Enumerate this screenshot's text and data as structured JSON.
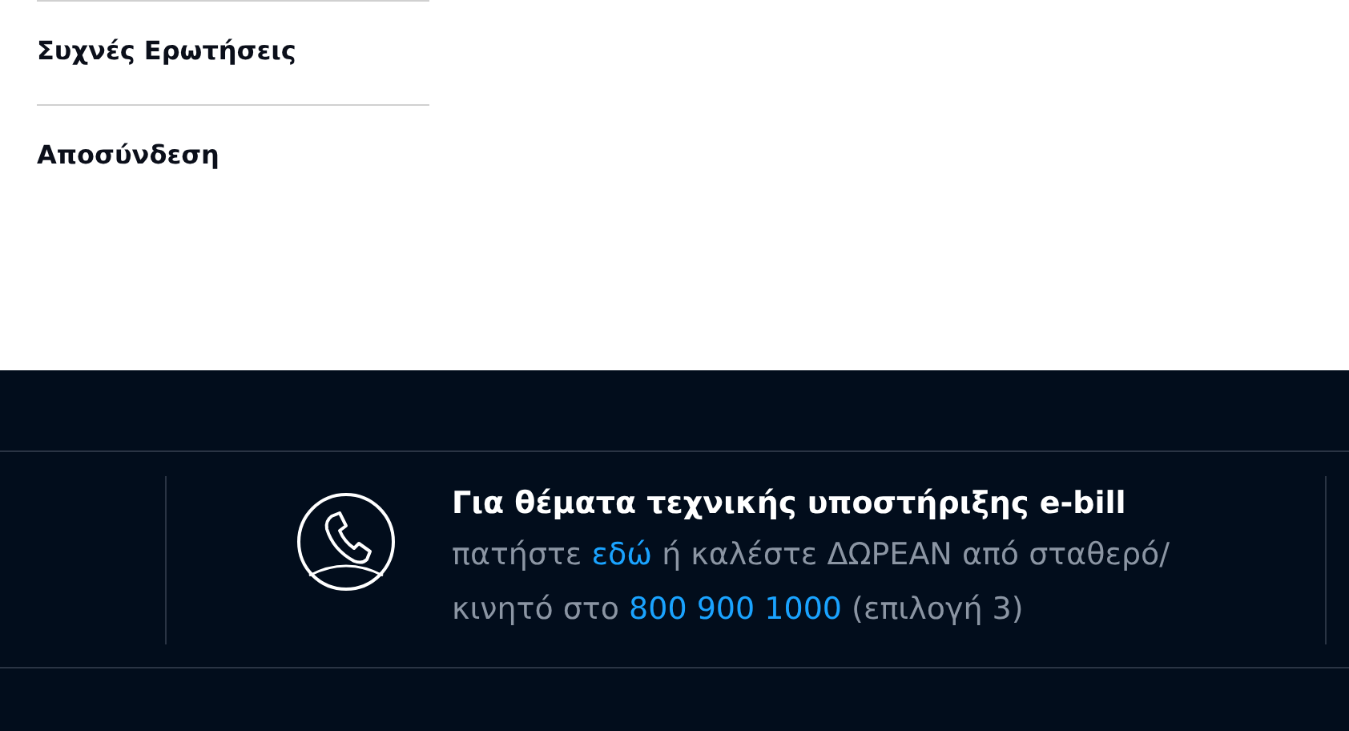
{
  "menu": [
    {
      "label": "Συχνές Ερωτήσεις"
    },
    {
      "label": "Αποσύνδεση"
    }
  ],
  "support": {
    "title": "Για θέματα τεχνικής υποστήριξης e-bill",
    "text": [
      {
        "kind": "text",
        "text": "πατήστε "
      },
      {
        "kind": "link",
        "text": "εδώ"
      },
      {
        "kind": "text",
        "text": " ή καλέστε ΔΩΡΕΑΝ από σταθερό/κινητό στο "
      },
      {
        "kind": "phone",
        "text": "800 900 1000"
      },
      {
        "kind": "text",
        "text": " (επιλογή 3)"
      }
    ]
  }
}
